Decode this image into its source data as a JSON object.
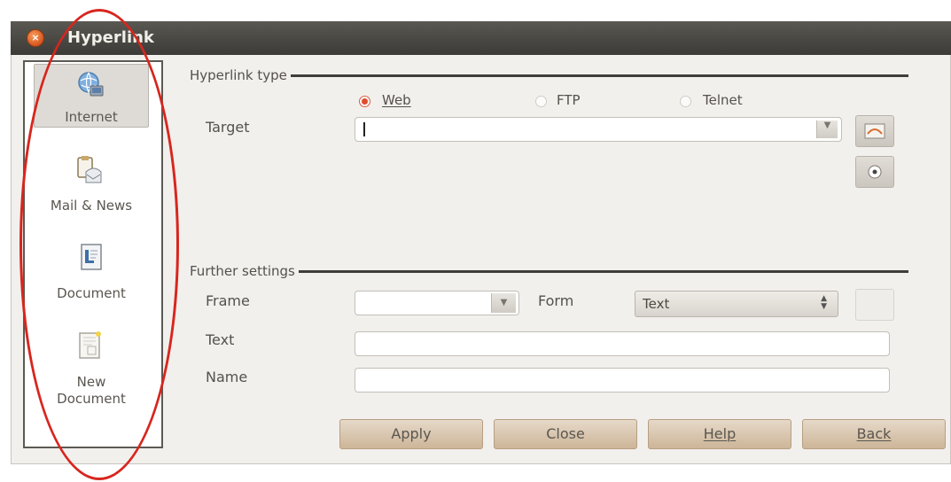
{
  "window": {
    "title": "Hyperlink"
  },
  "sidebar": {
    "items": [
      {
        "label": "Internet",
        "icon": "globe-icon",
        "selected": true
      },
      {
        "label": "Mail & News",
        "icon": "mail-icon",
        "selected": false
      },
      {
        "label": "Document",
        "icon": "document-icon",
        "selected": false
      },
      {
        "label": "New\nDocument",
        "icon": "new-document-icon",
        "selected": false
      }
    ]
  },
  "hyperlink_type": {
    "section_label": "Hyperlink type",
    "options": [
      {
        "label": "Web",
        "selected": true
      },
      {
        "label": "FTP",
        "selected": false
      },
      {
        "label": "Telnet",
        "selected": false
      }
    ],
    "target_label": "Target",
    "target_value": ""
  },
  "further_settings": {
    "section_label": "Further settings",
    "frame_label": "Frame",
    "frame_value": "",
    "form_label": "Form",
    "form_value": "Text",
    "text_label": "Text",
    "text_value": "",
    "name_label": "Name",
    "name_value": ""
  },
  "buttons": {
    "apply": "Apply",
    "close": "Close",
    "help": "Help",
    "back": "Back"
  },
  "colors": {
    "title_bar": "#3c3b37",
    "button_fill": "#d9c7b0",
    "annotation_ellipse": "#d7261e",
    "radio_selected": "#e04a2c"
  }
}
